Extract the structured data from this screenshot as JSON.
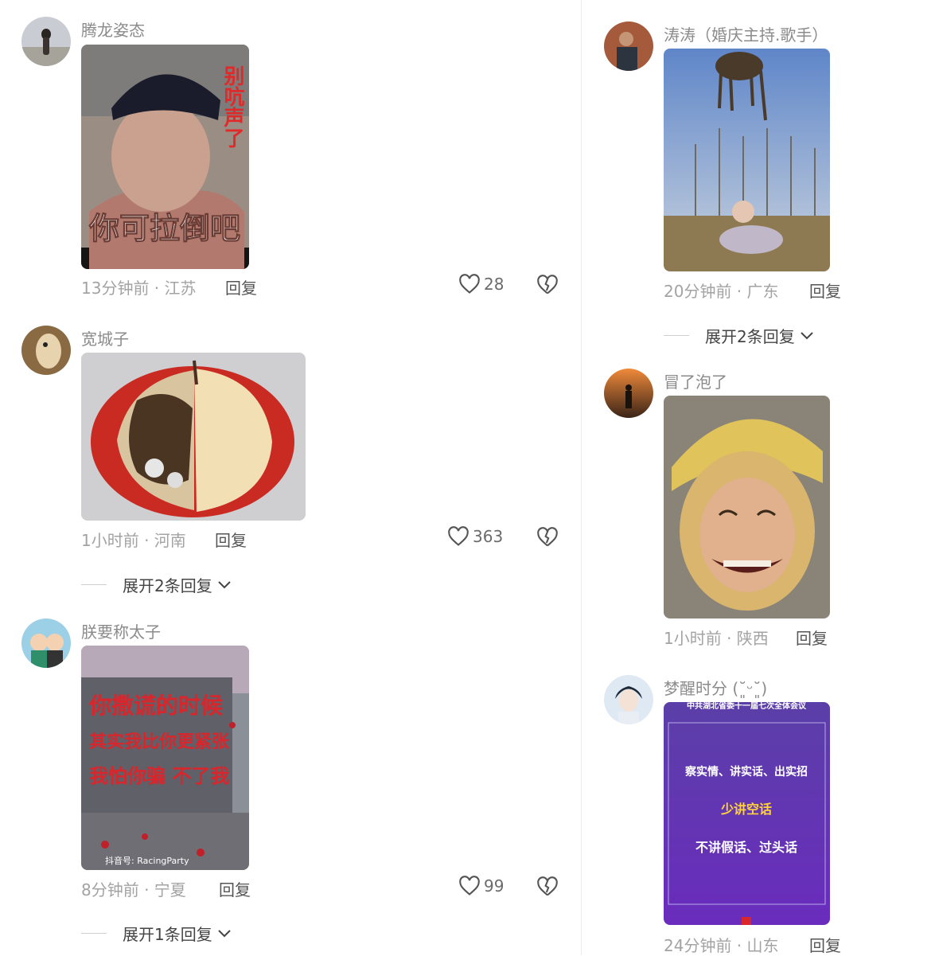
{
  "comments": [
    {
      "user": "腾龙姿态",
      "time": "13分钟前 · 江苏",
      "reply": "回复",
      "likes": "28",
      "image_text": {
        "side": "别吭声了",
        "bottom": "你可拉倒吧"
      }
    },
    {
      "user": "宽城子",
      "time": "1小时前 · 河南",
      "reply": "回复",
      "likes": "363",
      "expand": "展开2条回复"
    },
    {
      "user": "朕要称太子",
      "time": "8分钟前 · 宁夏",
      "reply": "回复",
      "likes": "99",
      "expand": "展开1条回复",
      "image_text": {
        "line1": "你撒谎的时候",
        "line2": "其实我比你更紧张",
        "line3": "我怕你骗 不了我",
        "watermark": "抖音号: RacingParty"
      }
    },
    {
      "user": "涛涛（婚庆主持.歌手）",
      "time": "20分钟前 · 广东",
      "reply": "回复",
      "expand": "展开2条回复"
    },
    {
      "user": "冒了泡了",
      "time": "1小时前 · 陕西",
      "reply": "回复"
    },
    {
      "user": "梦醒时分 (˘͈ᵕ˘͈)",
      "time": "24分钟前 · 山东",
      "reply": "回复",
      "image_text": {
        "header": "中共湖北省委十一届七次全体会议",
        "line1": "察实情、讲实话、出实招",
        "line2": "少讲空话",
        "line3": "不讲假话、过头话"
      }
    }
  ],
  "icons": {
    "like": "heart-outline-icon",
    "dislike": "broken-heart-icon",
    "expand": "chevron-down-icon"
  }
}
